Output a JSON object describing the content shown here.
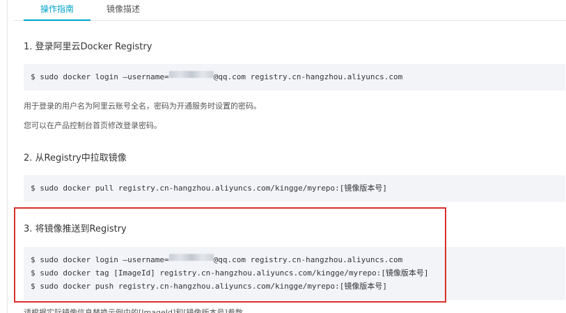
{
  "tabs": [
    {
      "label": "操作指南",
      "active": true
    },
    {
      "label": "镜像描述",
      "active": false
    }
  ],
  "sections": [
    {
      "title": "1. 登录阿里云Docker Registry",
      "commands": [
        {
          "before": "$ sudo docker login —username=",
          "after": "@qq.com registry.cn-hangzhou.aliyuncs.com",
          "redacted": true
        }
      ],
      "notes": [
        "用于登录的用户名为阿里云账号全名，密码为开通服务时设置的密码。",
        "您可以在产品控制台首页修改登录密码。"
      ]
    },
    {
      "title": "2. 从Registry中拉取镜像",
      "commands": [
        {
          "text": "$ sudo docker pull registry.cn-hangzhou.aliyuncs.com/kingge/myrepo:[镜像版本号]"
        }
      ]
    },
    {
      "title": "3. 将镜像推送到Registry",
      "commands": [
        {
          "before": "$ sudo docker login —username=",
          "after": "@qq.com registry.cn-hangzhou.aliyuncs.com",
          "redacted": true
        },
        {
          "text": "$ sudo docker tag [ImageId] registry.cn-hangzhou.aliyuncs.com/kingge/myrepo:[镜像版本号]"
        },
        {
          "text": "$ sudo docker push registry.cn-hangzhou.aliyuncs.com/kingge/myrepo:[镜像版本号]"
        }
      ]
    }
  ],
  "footer_partial": "请根据实际镜像信息替换示例中的[ImageId]和[镜像版本号]参数。",
  "colors": {
    "accent": "#00a2ca",
    "highlight_border": "#d9302c",
    "code_bg": "#f2f4f8"
  }
}
